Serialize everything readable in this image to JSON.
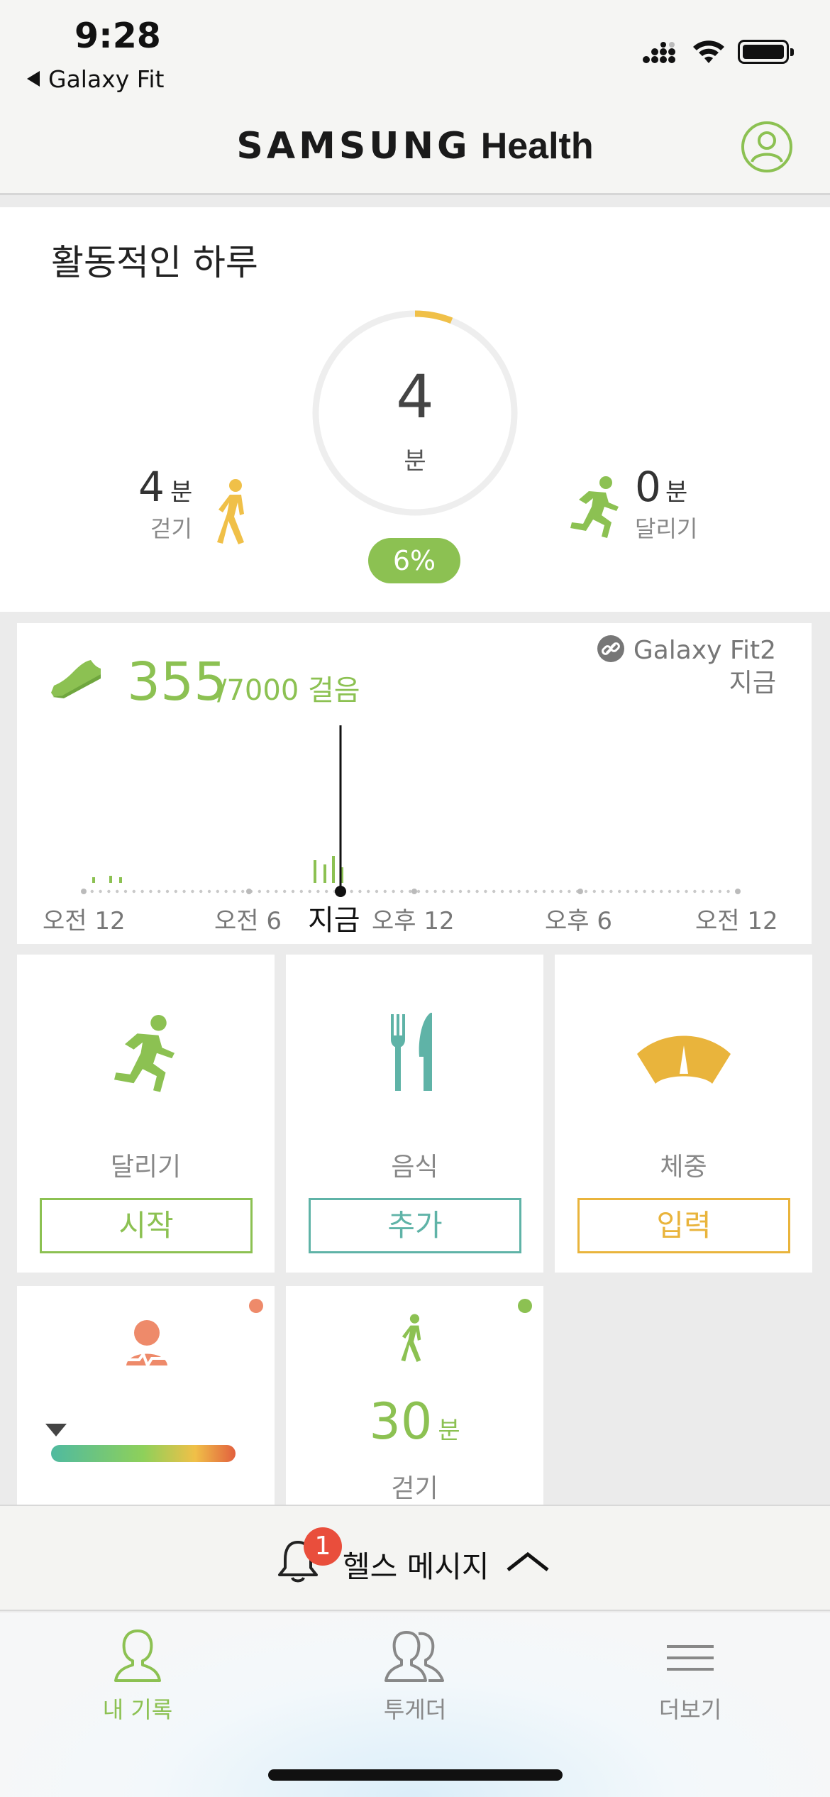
{
  "status_bar": {
    "time": "9:28",
    "back_app": "Galaxy Fit"
  },
  "header": {
    "brand": "SAMSUNG",
    "product": "Health",
    "profile_icon": "person-circle-icon"
  },
  "activity": {
    "title": "활동적인 하루",
    "total_value": "4",
    "total_unit": "분",
    "progress_percent_label": "6%",
    "progress_fraction": 0.06,
    "walk": {
      "value": "4",
      "unit": "분",
      "label": "걷기"
    },
    "run": {
      "value": "0",
      "unit": "분",
      "label": "달리기"
    },
    "colors": {
      "accent": "#8cc152",
      "ring_progress": "#f0c048",
      "ring_track": "#eeeeee"
    }
  },
  "steps": {
    "value": "355",
    "goal": "/7000 걸음",
    "device_name": "Galaxy Fit2",
    "device_time": "지금",
    "axis_labels": [
      "오전 12",
      "오전 6",
      "지금",
      "오후 12",
      "오후 6",
      "오전 12"
    ]
  },
  "tiles": [
    {
      "label": "달리기",
      "button": "시작",
      "color": "#8cc152",
      "icon": "running-icon"
    },
    {
      "label": "음식",
      "button": "추가",
      "color": "#5fb3a7",
      "icon": "fork-knife-icon"
    },
    {
      "label": "체중",
      "button": "입력",
      "color": "#e9b43c",
      "icon": "scale-icon"
    }
  ],
  "tiles_row2": {
    "stress": {
      "icon": "stress-person-icon",
      "dot_color": "#ee8a6a"
    },
    "walk": {
      "value": "30",
      "unit": "분",
      "label": "걷기",
      "dot_color": "#8cc152"
    }
  },
  "messages": {
    "badge_count": "1",
    "label": "헬스 메시지"
  },
  "nav": [
    {
      "label": "내 기록",
      "active": true
    },
    {
      "label": "투게더",
      "active": false
    },
    {
      "label": "더보기",
      "active": false
    }
  ]
}
